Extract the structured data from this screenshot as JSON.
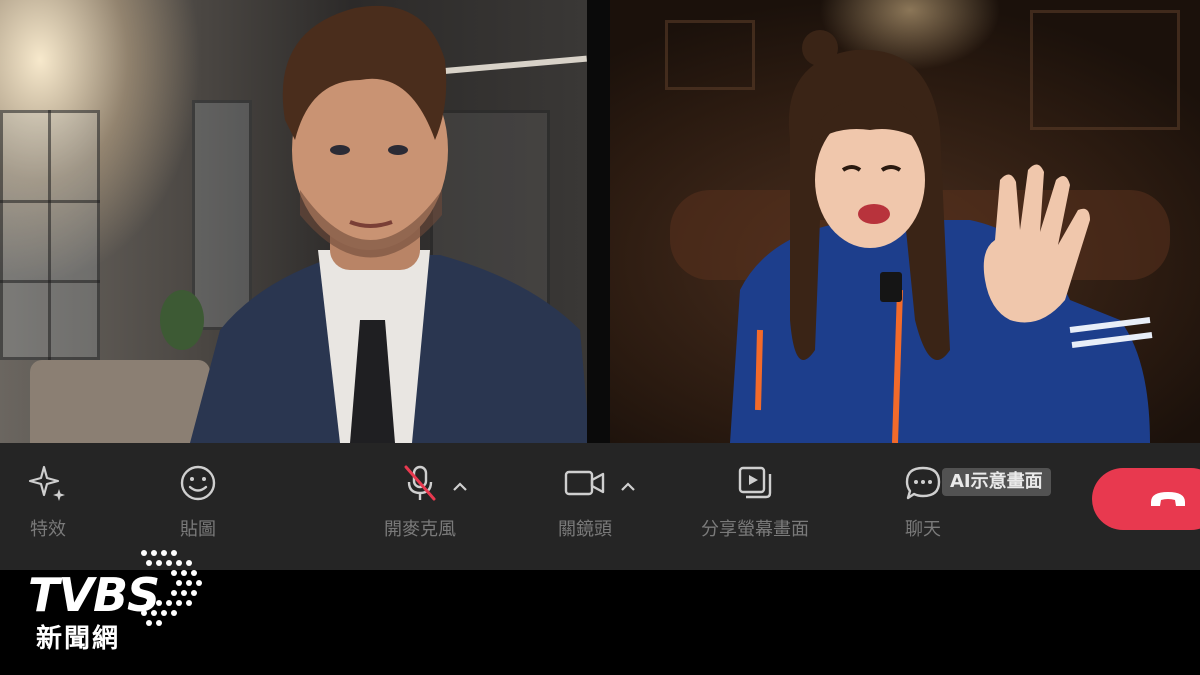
{
  "toolbar": {
    "effects_label": "特效",
    "stickers_label": "貼圖",
    "mic_label": "開麥克風",
    "camera_label": "關鏡頭",
    "share_label": "分享螢幕畫面",
    "chat_label": "聊天"
  },
  "overlay": {
    "ai_notice": "AI示意畫面"
  },
  "watermark": {
    "brand": "TVBS",
    "subtitle": "新聞網"
  },
  "colors": {
    "end_call": "#e8394f",
    "toolbar_bg": "#252525",
    "mic_muted_slash": "#e8394f"
  },
  "icons": {
    "effects": "sparkle-icon",
    "stickers": "smiley-icon",
    "mic": "mic-muted-icon",
    "camera": "video-camera-icon",
    "share": "screen-share-icon",
    "chat": "chat-bubble-icon",
    "end_call": "hang-up-icon"
  },
  "state": {
    "mic_muted": true
  }
}
